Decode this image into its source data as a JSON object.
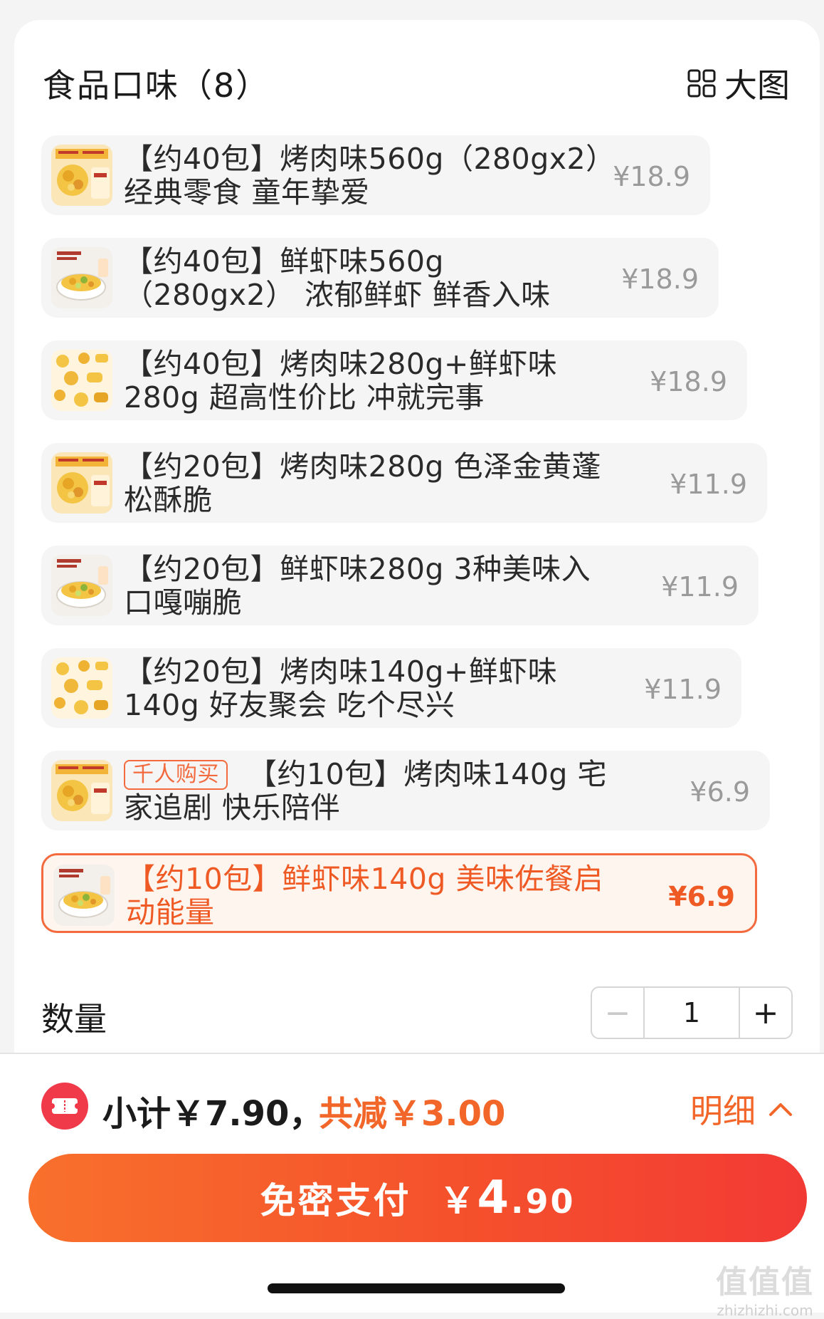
{
  "header": {
    "title": "食品口味（8）",
    "view_label": "大图",
    "view_icon": "grid-icon"
  },
  "options": [
    {
      "text": "【约40包】烤肉味560g（280gx2）经典零食 童年挚爱",
      "price": "¥18.9",
      "thumb": "package"
    },
    {
      "text": "【约40包】鲜虾味560g（280gx2） 浓郁鲜虾 鲜香入味",
      "price": "¥18.9",
      "thumb": "bowl"
    },
    {
      "text": "【约40包】烤肉味280g+鲜虾味280g 超高性价比 冲就完事",
      "price": "¥18.9",
      "thumb": "snacks"
    },
    {
      "text": "【约20包】烤肉味280g 色泽金黄蓬松酥脆",
      "price": "¥11.9",
      "thumb": "package"
    },
    {
      "text": "【约20包】鲜虾味280g 3种美味入口嘎嘣脆",
      "price": "¥11.9",
      "thumb": "bowl"
    },
    {
      "text": "【约20包】烤肉味140g+鲜虾味140g 好友聚会 吃个尽兴",
      "price": "¥11.9",
      "thumb": "snacks"
    },
    {
      "tag": "千人购买",
      "text": "【约10包】烤肉味140g 宅家追剧 快乐陪伴",
      "price": "¥6.9",
      "thumb": "package"
    },
    {
      "text": "【约10包】鲜虾味140g 美味佐餐启动能量",
      "price": "¥6.9",
      "thumb": "bowl",
      "selected": true
    }
  ],
  "quantity": {
    "label": "数量",
    "minus": "−",
    "value": "1",
    "plus": "+"
  },
  "summary": {
    "subtotal": "小计￥7.90，",
    "reduced": "共减￥3.00",
    "detail": "明细",
    "coupon_icon": "coupon-icon",
    "detail_icon": "chevron-up-icon"
  },
  "pay": {
    "label": "免密支付",
    "currency": "￥",
    "int": "4",
    "dec": ".90"
  },
  "watermark": {
    "big": "值值值",
    "small": "zhizhizhi.com"
  },
  "colors": {
    "accent": "#f26a3d",
    "pay_start": "#f8702c",
    "pay_end": "#f23a35"
  }
}
